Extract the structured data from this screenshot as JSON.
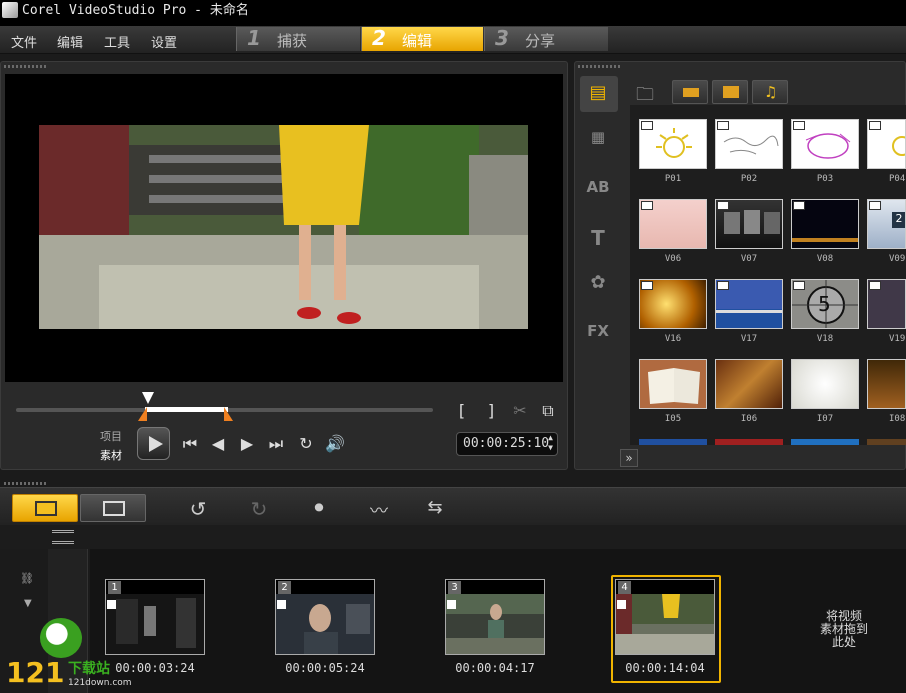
{
  "window": {
    "title": "Corel VideoStudio Pro - 未命名"
  },
  "menu": {
    "file": "文件",
    "edit": "编辑",
    "tools": "工具",
    "settings": "设置"
  },
  "steps": [
    {
      "num": "1",
      "label": "捕获"
    },
    {
      "num": "2",
      "label": "编辑"
    },
    {
      "num": "3",
      "label": "分享"
    }
  ],
  "player": {
    "project_label": "项目",
    "clip_label": "素材",
    "timecode": "00:00:25:10",
    "mark_in": "[",
    "mark_out": "]"
  },
  "library": {
    "thumbnails": [
      {
        "label": "P01"
      },
      {
        "label": "P02"
      },
      {
        "label": "P03"
      },
      {
        "label": "P04"
      },
      {
        "label": "V06"
      },
      {
        "label": "V07"
      },
      {
        "label": "V08"
      },
      {
        "label": "V09"
      },
      {
        "label": "V16"
      },
      {
        "label": "V17"
      },
      {
        "label": "V18"
      },
      {
        "label": "V19"
      },
      {
        "label": "I05"
      },
      {
        "label": "I06"
      },
      {
        "label": "I07"
      },
      {
        "label": "I08"
      }
    ],
    "v18_digit": "5",
    "v09_digit": "2",
    "expand": "»"
  },
  "storyboard": {
    "clips": [
      {
        "index": "1",
        "duration": "00:00:03:24"
      },
      {
        "index": "2",
        "duration": "00:00:05:24"
      },
      {
        "index": "3",
        "duration": "00:00:04:17"
      },
      {
        "index": "4",
        "duration": "00:00:14:04"
      }
    ],
    "drop_hint_1": "将视频",
    "drop_hint_2": "素材拖到",
    "drop_hint_3": "此处"
  },
  "watermark": {
    "brand": "121",
    "cn": "下载站",
    "url": "121down.com"
  },
  "colors": {
    "accent": "#f0b400",
    "panel": "#2a2a2a"
  }
}
